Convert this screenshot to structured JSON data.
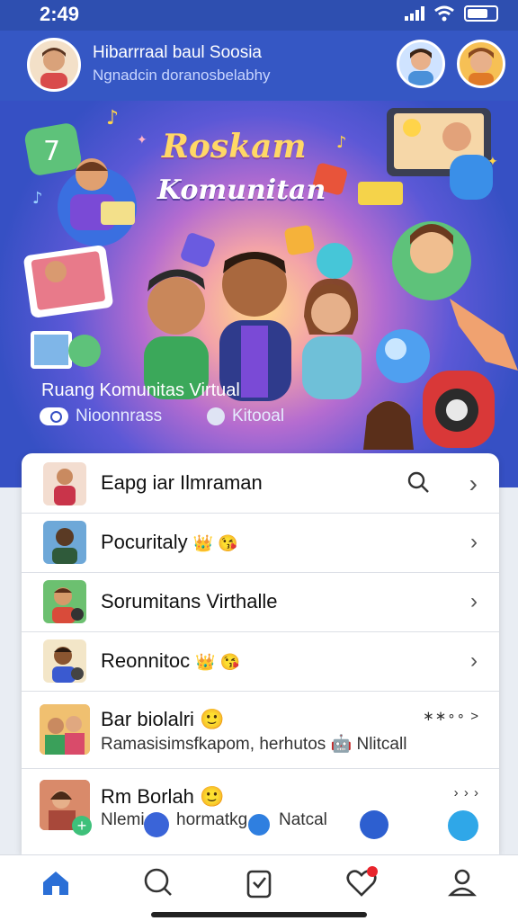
{
  "status_bar": {
    "time": "2:49"
  },
  "header": {
    "title": "Hibarrraal baul Soosia",
    "subtitle": "Ngnadcin doranosbelabhy"
  },
  "hero": {
    "title_line1": "Roskam",
    "title_line2": "Komunitan",
    "caption": "Ruang Komunitas Virtual",
    "option1": "Nioonnrass",
    "option2": "Kitooal"
  },
  "list": {
    "items": [
      {
        "title": "Eapg iar Ilmraman",
        "has_search": true
      },
      {
        "title": "Pocuritaly",
        "emoji": "👑 😘"
      },
      {
        "title": "Sorumitans Virthalle"
      },
      {
        "title": "Reonnitoc",
        "emoji": "👑 😘"
      },
      {
        "title": "Bar biolalri 🙂",
        "subtitle": "Ramasisimsfkapom, herhutos 🤖 Nlitcall",
        "meta": "∗∗∘∘ >"
      },
      {
        "title": "Rm Borlah 🙂",
        "subtitle_part1": "Nlemi",
        "subtitle_part2": "hormatkg",
        "subtitle_part3": "Natcal",
        "meta": "› › ›"
      }
    ]
  },
  "colors": {
    "accent": "#3557c4",
    "badge": "#e8242c",
    "nav_active": "#2b6fd6"
  }
}
